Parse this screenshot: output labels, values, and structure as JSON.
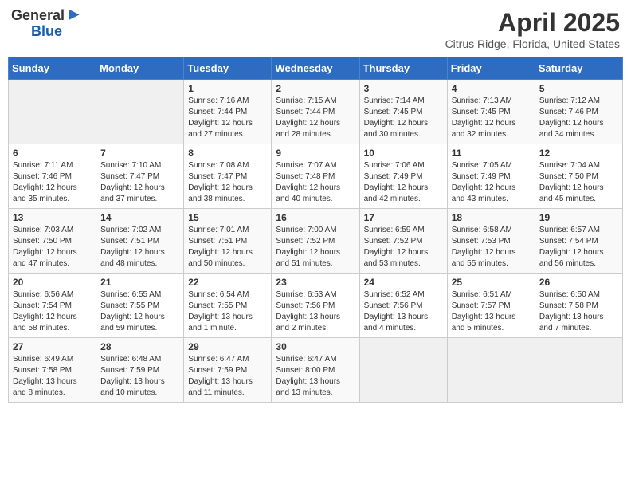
{
  "header": {
    "logo_line1": "General",
    "logo_line2": "Blue",
    "month_year": "April 2025",
    "location": "Citrus Ridge, Florida, United States"
  },
  "days_of_week": [
    "Sunday",
    "Monday",
    "Tuesday",
    "Wednesday",
    "Thursday",
    "Friday",
    "Saturday"
  ],
  "weeks": [
    [
      {
        "num": "",
        "info": ""
      },
      {
        "num": "",
        "info": ""
      },
      {
        "num": "1",
        "info": "Sunrise: 7:16 AM\nSunset: 7:44 PM\nDaylight: 12 hours\nand 27 minutes."
      },
      {
        "num": "2",
        "info": "Sunrise: 7:15 AM\nSunset: 7:44 PM\nDaylight: 12 hours\nand 28 minutes."
      },
      {
        "num": "3",
        "info": "Sunrise: 7:14 AM\nSunset: 7:45 PM\nDaylight: 12 hours\nand 30 minutes."
      },
      {
        "num": "4",
        "info": "Sunrise: 7:13 AM\nSunset: 7:45 PM\nDaylight: 12 hours\nand 32 minutes."
      },
      {
        "num": "5",
        "info": "Sunrise: 7:12 AM\nSunset: 7:46 PM\nDaylight: 12 hours\nand 34 minutes."
      }
    ],
    [
      {
        "num": "6",
        "info": "Sunrise: 7:11 AM\nSunset: 7:46 PM\nDaylight: 12 hours\nand 35 minutes."
      },
      {
        "num": "7",
        "info": "Sunrise: 7:10 AM\nSunset: 7:47 PM\nDaylight: 12 hours\nand 37 minutes."
      },
      {
        "num": "8",
        "info": "Sunrise: 7:08 AM\nSunset: 7:47 PM\nDaylight: 12 hours\nand 38 minutes."
      },
      {
        "num": "9",
        "info": "Sunrise: 7:07 AM\nSunset: 7:48 PM\nDaylight: 12 hours\nand 40 minutes."
      },
      {
        "num": "10",
        "info": "Sunrise: 7:06 AM\nSunset: 7:49 PM\nDaylight: 12 hours\nand 42 minutes."
      },
      {
        "num": "11",
        "info": "Sunrise: 7:05 AM\nSunset: 7:49 PM\nDaylight: 12 hours\nand 43 minutes."
      },
      {
        "num": "12",
        "info": "Sunrise: 7:04 AM\nSunset: 7:50 PM\nDaylight: 12 hours\nand 45 minutes."
      }
    ],
    [
      {
        "num": "13",
        "info": "Sunrise: 7:03 AM\nSunset: 7:50 PM\nDaylight: 12 hours\nand 47 minutes."
      },
      {
        "num": "14",
        "info": "Sunrise: 7:02 AM\nSunset: 7:51 PM\nDaylight: 12 hours\nand 48 minutes."
      },
      {
        "num": "15",
        "info": "Sunrise: 7:01 AM\nSunset: 7:51 PM\nDaylight: 12 hours\nand 50 minutes."
      },
      {
        "num": "16",
        "info": "Sunrise: 7:00 AM\nSunset: 7:52 PM\nDaylight: 12 hours\nand 51 minutes."
      },
      {
        "num": "17",
        "info": "Sunrise: 6:59 AM\nSunset: 7:52 PM\nDaylight: 12 hours\nand 53 minutes."
      },
      {
        "num": "18",
        "info": "Sunrise: 6:58 AM\nSunset: 7:53 PM\nDaylight: 12 hours\nand 55 minutes."
      },
      {
        "num": "19",
        "info": "Sunrise: 6:57 AM\nSunset: 7:54 PM\nDaylight: 12 hours\nand 56 minutes."
      }
    ],
    [
      {
        "num": "20",
        "info": "Sunrise: 6:56 AM\nSunset: 7:54 PM\nDaylight: 12 hours\nand 58 minutes."
      },
      {
        "num": "21",
        "info": "Sunrise: 6:55 AM\nSunset: 7:55 PM\nDaylight: 12 hours\nand 59 minutes."
      },
      {
        "num": "22",
        "info": "Sunrise: 6:54 AM\nSunset: 7:55 PM\nDaylight: 13 hours\nand 1 minute."
      },
      {
        "num": "23",
        "info": "Sunrise: 6:53 AM\nSunset: 7:56 PM\nDaylight: 13 hours\nand 2 minutes."
      },
      {
        "num": "24",
        "info": "Sunrise: 6:52 AM\nSunset: 7:56 PM\nDaylight: 13 hours\nand 4 minutes."
      },
      {
        "num": "25",
        "info": "Sunrise: 6:51 AM\nSunset: 7:57 PM\nDaylight: 13 hours\nand 5 minutes."
      },
      {
        "num": "26",
        "info": "Sunrise: 6:50 AM\nSunset: 7:58 PM\nDaylight: 13 hours\nand 7 minutes."
      }
    ],
    [
      {
        "num": "27",
        "info": "Sunrise: 6:49 AM\nSunset: 7:58 PM\nDaylight: 13 hours\nand 8 minutes."
      },
      {
        "num": "28",
        "info": "Sunrise: 6:48 AM\nSunset: 7:59 PM\nDaylight: 13 hours\nand 10 minutes."
      },
      {
        "num": "29",
        "info": "Sunrise: 6:47 AM\nSunset: 7:59 PM\nDaylight: 13 hours\nand 11 minutes."
      },
      {
        "num": "30",
        "info": "Sunrise: 6:47 AM\nSunset: 8:00 PM\nDaylight: 13 hours\nand 13 minutes."
      },
      {
        "num": "",
        "info": ""
      },
      {
        "num": "",
        "info": ""
      },
      {
        "num": "",
        "info": ""
      }
    ]
  ]
}
